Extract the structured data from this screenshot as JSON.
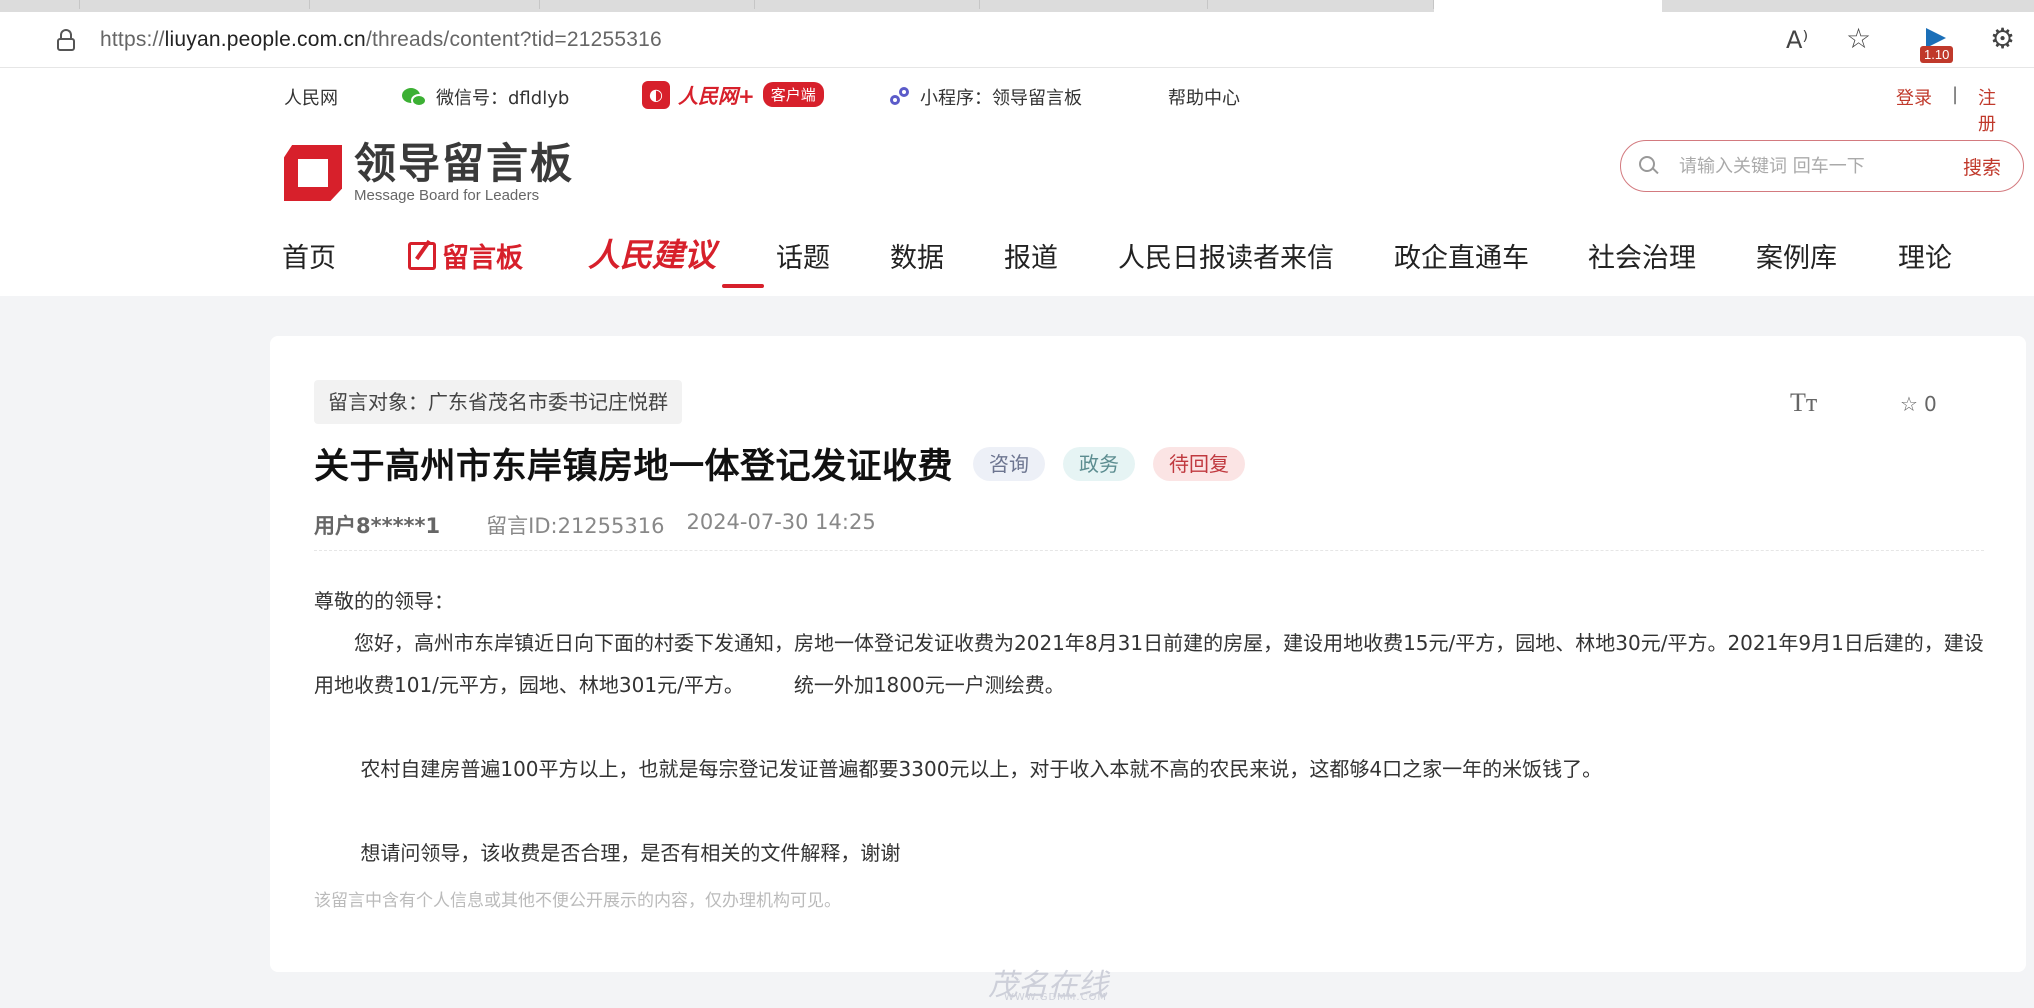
{
  "browser": {
    "url_prefix": "https://",
    "url_domain": "liuyan.people.com.cn",
    "url_path": "/threads/content?tid=21255316",
    "read_aloud_icon": "A⁾",
    "favorite_icon": "☆",
    "extension_badge": "1.10",
    "extensions_icon": "⚙"
  },
  "topbar": {
    "people_net": "人民网",
    "wechat": "微信号：dfldlyb",
    "app_logo_text": "人民网+",
    "app_badge": "客户端",
    "miniprogram": "小程序：领导留言板",
    "help": "帮助中心",
    "login": "登录",
    "separator": "|",
    "register": "注册"
  },
  "logo": {
    "cn": "领导留言板",
    "en": "Message Board for Leaders"
  },
  "search": {
    "placeholder": "请输入关键词 回车一下",
    "button": "搜索"
  },
  "nav": {
    "home": "首页",
    "board": "留言板",
    "suggest": "人民建议",
    "topics": "话题",
    "data": "数据",
    "reports": "报道",
    "letters": "人民日报读者来信",
    "enterprise": "政企直通车",
    "governance": "社会治理",
    "cases": "案例库",
    "theory": "理论"
  },
  "message": {
    "target": "留言对象：广东省茂名市委书记庄悦群",
    "font_toggle": "Tᴛ",
    "favorite_count": "0",
    "title": "关于高州市东岸镇房地一体登记发证收费",
    "tags": {
      "consult": "咨询",
      "gov": "政务",
      "status": "待回复"
    },
    "user": "用户8*****1",
    "msg_id": "留言ID:21255316",
    "datetime": "2024-07-30 14:25",
    "greeting": "尊敬的的领导：",
    "para1": "　　您好，高州市东岸镇近日向下面的村委下发通知，房地一体登记发证收费为2021年8月31日前建的房屋，建设用地收费15元/平方，园地、林地30元/平方。2021年9月1日后建的，建设用地收费101/元平方，园地、林地301元/平方。　　　统一外加1800元一户测绘费。",
    "para2": "　　 农村自建房普遍100平方以上，也就是每宗登记发证普遍都要3300元以上，对于收入本就不高的农民来说，这都够4口之家一年的米饭钱了。",
    "para3": "　　 想请问领导，该收费是否合理，是否有相关的文件解释，谢谢",
    "notice": "该留言中含有个人信息或其他不便公开展示的内容，仅办理机构可见。"
  },
  "watermark": {
    "main": "茂名在线",
    "sub": "WWW.GDMM.COM"
  }
}
